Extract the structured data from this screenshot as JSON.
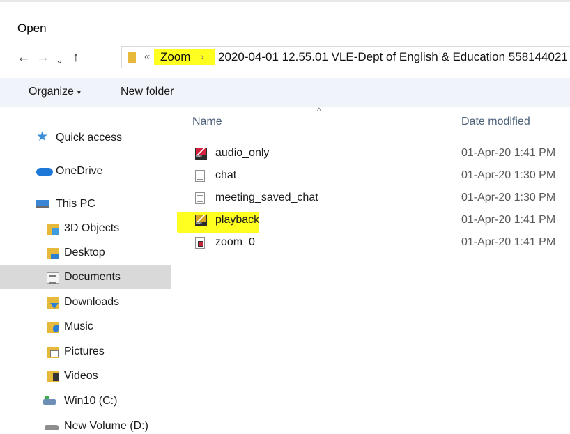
{
  "window": {
    "title": "Open"
  },
  "address": {
    "overflow": "«",
    "crumb_zoom": "Zoom",
    "separator": "›",
    "path": "2020-04-01 12.55.01 VLE-Dept of English & Education 558144021"
  },
  "toolbar": {
    "organize_label": "Organize",
    "organize_caret": "▾",
    "new_folder_label": "New folder"
  },
  "nav": {
    "back": "←",
    "forward": "→",
    "recent": "⌄",
    "up": "↑"
  },
  "sidebar": {
    "items": [
      {
        "label": "Quick access",
        "icon": "star-icon"
      },
      {
        "label": "OneDrive",
        "icon": "cloud-icon"
      },
      {
        "label": "This PC",
        "icon": "computer-icon"
      },
      {
        "label": "3D Objects",
        "icon": "3d-objects-folder-icon"
      },
      {
        "label": "Desktop",
        "icon": "desktop-folder-icon"
      },
      {
        "label": "Documents",
        "icon": "documents-folder-icon",
        "selected": true
      },
      {
        "label": "Downloads",
        "icon": "downloads-folder-icon"
      },
      {
        "label": "Music",
        "icon": "music-folder-icon"
      },
      {
        "label": "Pictures",
        "icon": "pictures-folder-icon"
      },
      {
        "label": "Videos",
        "icon": "videos-folder-icon"
      },
      {
        "label": "Win10 (C:)",
        "icon": "windows-drive-icon"
      },
      {
        "label": "New Volume (D:)",
        "icon": "drive-icon"
      }
    ]
  },
  "columns": {
    "name": "Name",
    "date_modified": "Date modified",
    "sort_indicator": "^"
  },
  "files": [
    {
      "name": "audio_only",
      "date": "01-Apr-20 1:41 PM",
      "icon": "media-file-icon"
    },
    {
      "name": "chat",
      "date": "01-Apr-20 1:30 PM",
      "icon": "text-file-icon"
    },
    {
      "name": "meeting_saved_chat",
      "date": "01-Apr-20 1:30 PM",
      "icon": "text-file-icon"
    },
    {
      "name": "playback",
      "date": "01-Apr-20 1:41 PM",
      "icon": "media-file-icon",
      "highlighted": true
    },
    {
      "name": "zoom_0",
      "date": "01-Apr-20 1:41 PM",
      "icon": "audio-file-icon"
    }
  ],
  "colors": {
    "highlight": "#ffff20",
    "toolbar_bg": "#f0f3f9",
    "selected_bg": "#d9d9d9",
    "header_text": "#4c607a"
  }
}
